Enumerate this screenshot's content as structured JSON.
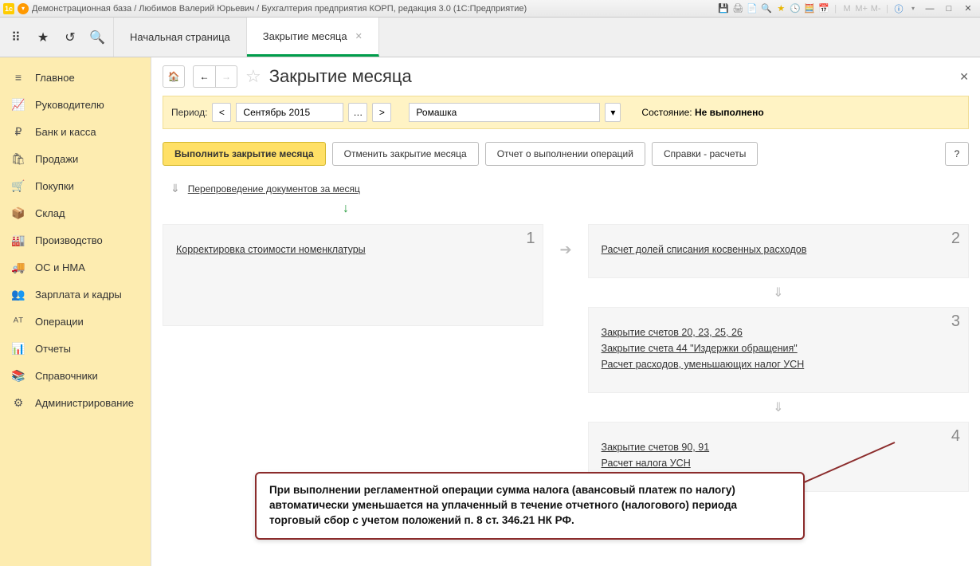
{
  "titlebar": {
    "text": "Демонстрационная база / Любимов Валерий Юрьевич / Бухгалтерия предприятия КОРП, редакция 3.0  (1С:Предприятие)",
    "m_labels": [
      "M",
      "M+",
      "M-"
    ]
  },
  "tabs": {
    "home": "Начальная страница",
    "active": "Закрытие месяца"
  },
  "sidebar": {
    "items": [
      {
        "icon": "≡",
        "label": "Главное"
      },
      {
        "icon": "📈",
        "label": "Руководителю"
      },
      {
        "icon": "₽",
        "label": "Банк и касса"
      },
      {
        "icon": "🛍",
        "label": "Продажи"
      },
      {
        "icon": "🛒",
        "label": "Покупки"
      },
      {
        "icon": "📦",
        "label": "Склад"
      },
      {
        "icon": "🏭",
        "label": "Производство"
      },
      {
        "icon": "🚚",
        "label": "ОС и НМА"
      },
      {
        "icon": "👥",
        "label": "Зарплата и кадры"
      },
      {
        "icon": "ᴬᵀ",
        "label": "Операции"
      },
      {
        "icon": "📊",
        "label": "Отчеты"
      },
      {
        "icon": "📚",
        "label": "Справочники"
      },
      {
        "icon": "⚙",
        "label": "Администрирование"
      }
    ]
  },
  "header": {
    "title": "Закрытие месяца"
  },
  "period": {
    "label": "Период:",
    "value": "Сентябрь 2015",
    "org": "Ромашка",
    "state_label": "Состояние:",
    "state_value": "Не выполнено"
  },
  "actions": {
    "primary": "Выполнить закрытие месяца",
    "cancel": "Отменить закрытие месяца",
    "report": "Отчет о выполнении операций",
    "refs": "Справки - расчеты",
    "help": "?"
  },
  "repost": {
    "label": "Перепроведение документов за месяц"
  },
  "steps": {
    "s1": {
      "num": "1",
      "links": [
        "Корректировка стоимости номенклатуры"
      ]
    },
    "s2": {
      "num": "2",
      "links": [
        "Расчет долей списания косвенных расходов"
      ]
    },
    "s3": {
      "num": "3",
      "links": [
        "Закрытие счетов 20, 23, 25, 26",
        "Закрытие счета 44 \"Издержки обращения\"",
        "Расчет расходов, уменьшающих налог УСН"
      ]
    },
    "s4": {
      "num": "4",
      "links": [
        "Закрытие счетов 90, 91",
        "Расчет налога УСН"
      ]
    }
  },
  "callout": {
    "text": "При выполнении регламентной операции сумма налога (авансовый платеж по налогу) автоматически уменьшается на уплаченный в течение отчетного (налогового) периода торговый сбор с учетом положений п. 8 ст. 346.21 НК РФ."
  }
}
